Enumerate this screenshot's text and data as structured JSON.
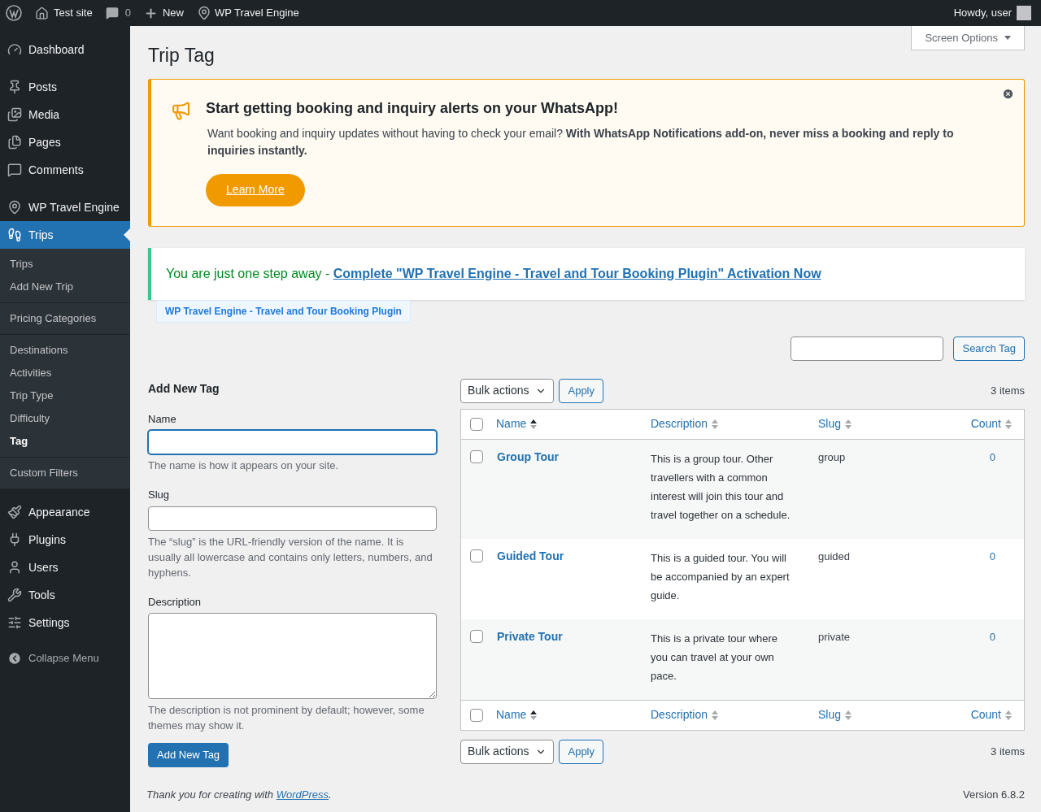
{
  "admin_bar": {
    "site": "Test site",
    "comments": "0",
    "new": "New",
    "plugin": "WP Travel Engine",
    "greeting": "Howdy, user"
  },
  "sidebar": {
    "groups": [
      [
        {
          "label": "Dashboard",
          "selected": false
        }
      ],
      [
        {
          "label": "Posts",
          "selected": false
        },
        {
          "label": "Media",
          "selected": false
        },
        {
          "label": "Pages",
          "selected": false
        },
        {
          "label": "Comments",
          "selected": false
        }
      ],
      [
        {
          "label": "WP Travel Engine",
          "selected": false
        },
        {
          "label": "Trips",
          "selected": true,
          "submenu": [
            [
              {
                "label": "Trips",
                "selected": false
              },
              {
                "label": "Add New Trip",
                "selected": false
              }
            ],
            [
              {
                "label": "Pricing Categories",
                "selected": false
              }
            ],
            [
              {
                "label": "Destinations",
                "selected": false
              },
              {
                "label": "Activities",
                "selected": false
              },
              {
                "label": "Trip Type",
                "selected": false
              },
              {
                "label": "Difficulty",
                "selected": false
              },
              {
                "label": "Tag",
                "selected": true
              }
            ],
            [
              {
                "label": "Custom Filters",
                "selected": false
              }
            ]
          ]
        }
      ],
      [
        {
          "label": "Appearance",
          "selected": false
        },
        {
          "label": "Plugins",
          "selected": false
        },
        {
          "label": "Users",
          "selected": false
        },
        {
          "label": "Tools",
          "selected": false
        },
        {
          "label": "Settings",
          "selected": false
        }
      ]
    ],
    "collapse": "Collapse Menu"
  },
  "page": {
    "title": "Trip Tag",
    "screen_options": "Screen Options"
  },
  "promo_notice": {
    "heading": "Start getting booking and inquiry alerts on your WhatsApp!",
    "body": "Want booking and inquiry updates without having to check your email? **With WhatsApp Notifications add-on, never miss a booking and reply to inquiries instantly.**",
    "button": "Learn More"
  },
  "activation_notice": {
    "text": "You are just one step away - ",
    "link": "Complete \"WP Travel Engine - Travel and Tour Booking Plugin\" Activation Now",
    "tag": "WP Travel Engine - Travel and Tour Booking Plugin"
  },
  "search": {
    "button": "Search Tag"
  },
  "form": {
    "heading": "Add New Tag",
    "fields": [
      {
        "kind": "input",
        "label": "Name",
        "help": "The name is how it appears on your site.",
        "focused": true
      },
      {
        "kind": "input",
        "label": "Slug",
        "help": "The “slug” is the URL-friendly version of the name. It is usually all lowercase and contains only letters, numbers, and hyphens.",
        "focused": false
      },
      {
        "kind": "textarea",
        "label": "Description",
        "help": "The description is not prominent by default; however, some themes may show it.",
        "focused": false
      }
    ],
    "button": "Add New Tag"
  },
  "table": {
    "select_all_checked": false,
    "footer_select_all_checked": false,
    "bulk_actions": "Bulk actions",
    "apply": "Apply",
    "count": "3 items",
    "columns": [
      {
        "label": "Name",
        "sorted": true
      },
      {
        "label": "Description",
        "sorted": false
      },
      {
        "label": "Slug",
        "sorted": false
      },
      {
        "label": "Count",
        "sorted": false
      }
    ],
    "rows": [
      {
        "name": "Group Tour",
        "description": "This is a group tour. Other travellers with a common interest will join this tour and travel together on a schedule.",
        "slug": "group",
        "count": "0",
        "checked": false
      },
      {
        "name": "Guided Tour",
        "description": "This is a guided tour. You will be accompanied by an expert guide.",
        "slug": "guided",
        "count": "0",
        "checked": false
      },
      {
        "name": "Private Tour",
        "description": "This is a private tour where you can travel at your own pace.",
        "slug": "private",
        "count": "0",
        "checked": false
      }
    ],
    "footer_columns": [
      {
        "label": "Name",
        "sorted": true
      },
      {
        "label": "Description",
        "sorted": false
      },
      {
        "label": "Slug",
        "sorted": false
      },
      {
        "label": "Count",
        "sorted": false
      }
    ],
    "bottom_bulk_actions": "Bulk actions",
    "bottom_apply": "Apply",
    "bottom_count": "3 items"
  },
  "footer": {
    "text_before": "Thank you for creating with ",
    "link": "WordPress",
    "text_after": ".",
    "version": "Version 6.8.2"
  }
}
